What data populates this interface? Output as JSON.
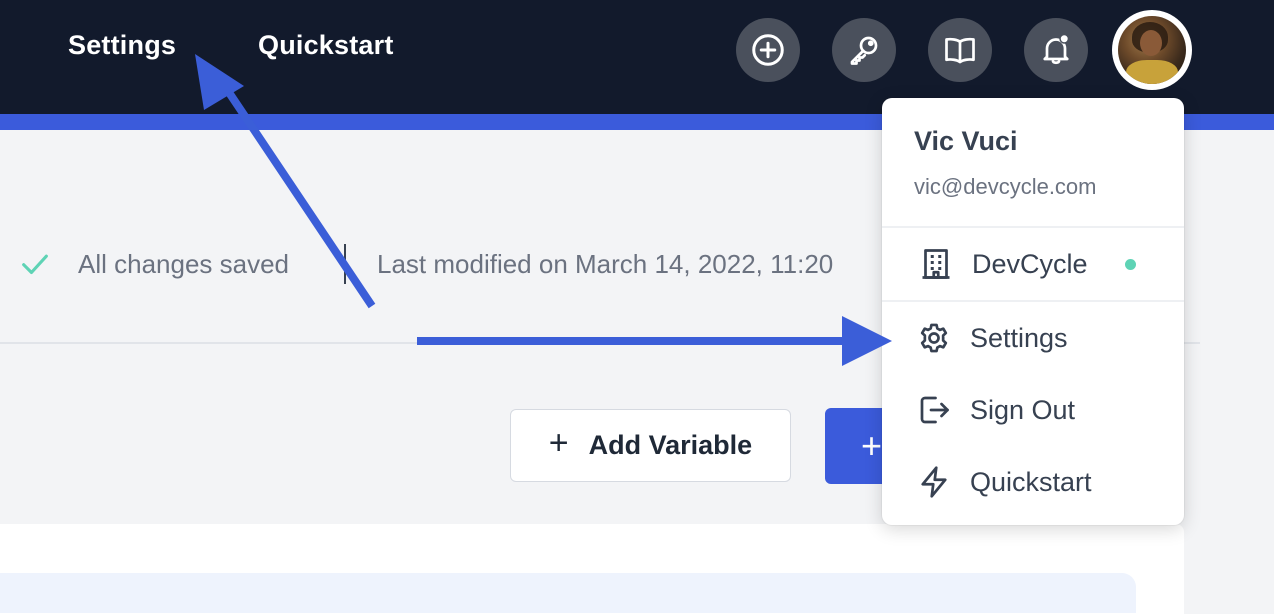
{
  "nav": {
    "settings_label": "Settings",
    "quickstart_label": "Quickstart"
  },
  "header_icons": [
    "plus-circle-icon",
    "key-icon",
    "book-icon",
    "bell-icon"
  ],
  "status": {
    "saved_text": "All changes saved",
    "modified_text": "Last modified on March 14, 2022, 11:20"
  },
  "actions": {
    "add_variable_label": "Add Variable",
    "add_variable_symbol": "+",
    "primary_symbol": "+"
  },
  "user_menu": {
    "name": "Vic Vuci",
    "email": "vic@devcycle.com",
    "org": "DevCycle",
    "items": [
      {
        "label": "Settings",
        "icon": "gear-icon"
      },
      {
        "label": "Sign Out",
        "icon": "sign-out-icon"
      },
      {
        "label": "Quickstart",
        "icon": "lightning-icon"
      }
    ]
  },
  "colors": {
    "topbar": "#121a2c",
    "accent": "#3b5bdb",
    "success": "#5ed3b5",
    "annotation_arrow": "#3b5ed8"
  }
}
